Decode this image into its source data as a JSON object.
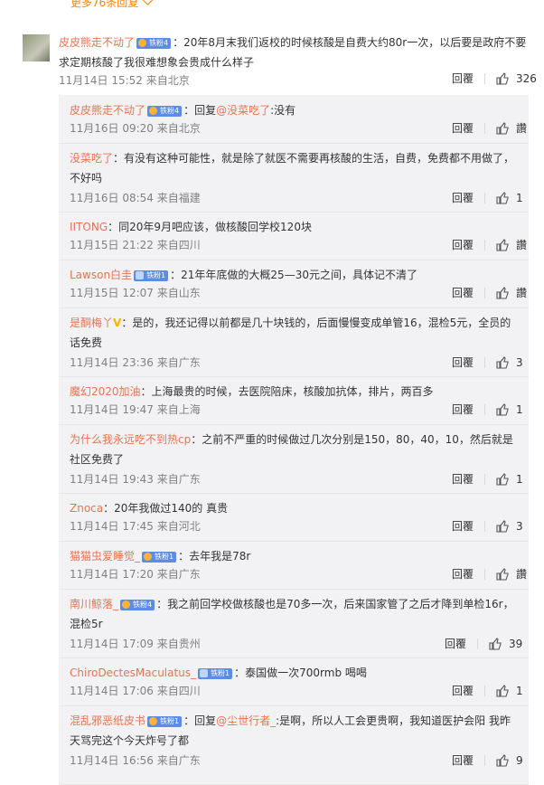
{
  "more_replies": "更多76条回复",
  "top_comment": {
    "user": "皮皮熊走不动了",
    "badge": "铁粉4",
    "text": "：20年8月末我们返校的时候核酸是自费大约80r一次，以后要是政府不要求定期核酸了我很难想象会贵成什么样子",
    "meta": "11月14日 15:52 来自北京",
    "reply_label": "回覆",
    "likes": "326"
  },
  "replies": [
    {
      "user": "皮皮熊走不动了",
      "badge": "铁粉4",
      "prefix": "：回复",
      "mention": "@没菜吃了",
      "text": ":没有",
      "meta": "11月16日 09:20 来自北京",
      "reply": "回覆",
      "likes": "讚"
    },
    {
      "user": "没菜吃了",
      "badge": "",
      "text": "：有没有这种可能性，就是除了就医不需要再核酸的生活，自费，免费都不用做了，不好吗",
      "meta": "11月16日 08:54 来自福建",
      "reply": "回覆",
      "likes": "1"
    },
    {
      "user": "IITONG",
      "badge": "",
      "text": "：同20年9月吧应该，做核酸回学校120块",
      "meta": "11月15日 21:22 来自四川",
      "reply": "回覆",
      "likes": "讚"
    },
    {
      "user": "Lawson白圭",
      "badge": "铁粉1",
      "text": "：21年年底做的大概25—30元之间，具体记不清了",
      "meta": "11月15日 12:07 来自山东",
      "reply": "回覆",
      "likes": "讚"
    },
    {
      "user": "是酮梅丫",
      "badge": "V",
      "text": "：是的，我还记得以前都是几十块钱的，后面慢慢变成单管16，混检5元，全员的话免费",
      "meta": "11月14日 23:36 来自广东",
      "reply": "回覆",
      "likes": "3"
    },
    {
      "user": "魔幻2020加油",
      "badge": "",
      "text": "：上海最贵的时候，去医院陪床，核酸加抗体，排片，两百多",
      "meta": "11月14日 19:47 来自上海",
      "reply": "回覆",
      "likes": "1"
    },
    {
      "user": "为什么我永远吃不到热cp",
      "badge": "",
      "text": "：之前不严重的时候做过几次分别是150，80，40，10，然后就是社区免费了",
      "meta": "11月14日 19:43 来自广东",
      "reply": "回覆",
      "likes": "1"
    },
    {
      "user": "Znoca",
      "badge": "",
      "text": "：20年我做过140的 真贵",
      "meta": "11月14日 17:45 来自河北",
      "reply": "回覆",
      "likes": "3"
    },
    {
      "user": "猫猫虫爱睡觉_",
      "badge": "铁粉1",
      "text": "：去年我是78r",
      "meta": "11月14日 17:20 来自广东",
      "reply": "回覆",
      "likes": "讚"
    },
    {
      "user": "南川鲸落_",
      "badge": "铁粉4",
      "text": "：我之前回学校做核酸也是70多一次，后来国家管了之后才降到单检16r，混检5r",
      "meta": "11月14日 17:09 来自贵州",
      "reply": "回覆",
      "likes": "39"
    },
    {
      "user": "ChiroDectesMaculatus_",
      "badge": "铁粉1",
      "text": "：泰国做一次700rmb 喝喝",
      "meta": "11月14日 17:06 来自四川",
      "reply": "回覆",
      "likes": "1"
    },
    {
      "user": "混乱邪恶纸皮书",
      "badge": "铁粉1",
      "prefix": "：回复",
      "mention": "@尘世行者_",
      "text": ":是啊，所以人工会更贵啊，我知道医护会阳 我昨天骂完这个今天炸号了都",
      "meta": "11月14日 16:56 来自广东",
      "reply": "回覆",
      "likes": "9"
    }
  ]
}
